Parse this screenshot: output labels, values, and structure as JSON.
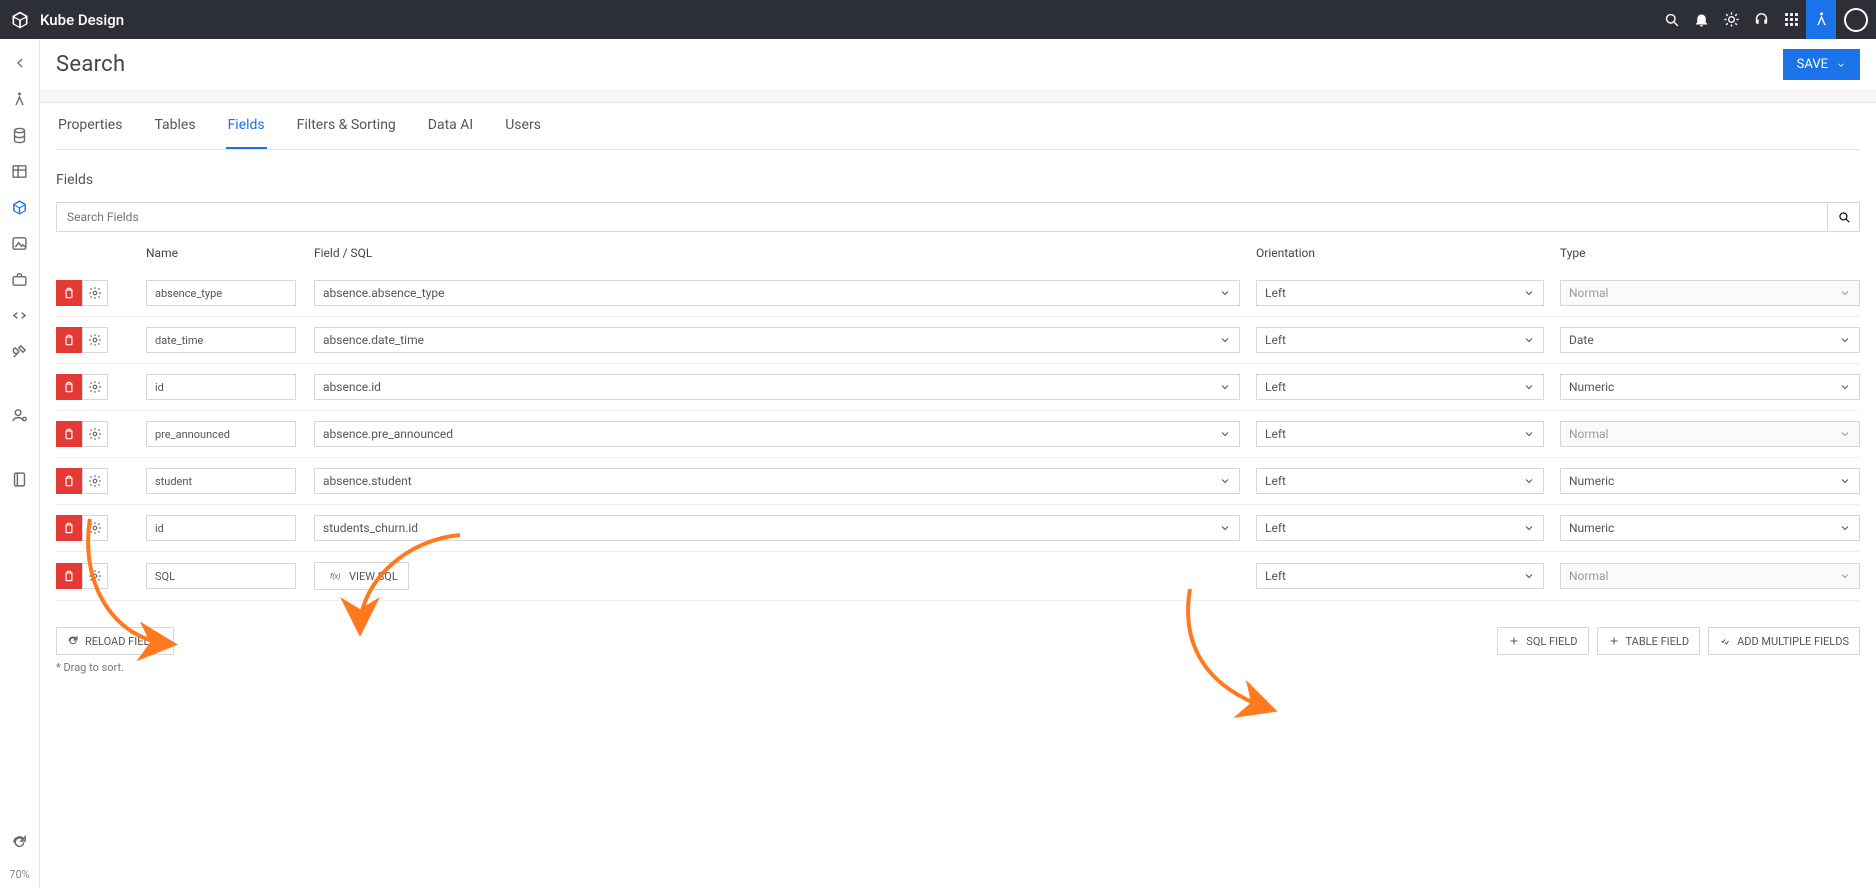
{
  "app": {
    "title": "Kube Design"
  },
  "page": {
    "title": "Search",
    "save": "SAVE"
  },
  "tabs": [
    {
      "label": "Properties",
      "active": false
    },
    {
      "label": "Tables",
      "active": false
    },
    {
      "label": "Fields",
      "active": true
    },
    {
      "label": "Filters & Sorting",
      "active": false
    },
    {
      "label": "Data AI",
      "active": false
    },
    {
      "label": "Users",
      "active": false
    }
  ],
  "section": {
    "title": "Fields"
  },
  "search": {
    "placeholder": "Search Fields"
  },
  "columns": {
    "name": "Name",
    "field": "Field / SQL",
    "orient": "Orientation",
    "type": "Type"
  },
  "rows": [
    {
      "name": "absence_type",
      "field": "absence.absence_type",
      "orient": "Left",
      "type": "Normal",
      "type_readonly": true,
      "sql": false
    },
    {
      "name": "date_time",
      "field": "absence.date_time",
      "orient": "Left",
      "type": "Date",
      "type_readonly": false,
      "sql": false
    },
    {
      "name": "id",
      "field": "absence.id",
      "orient": "Left",
      "type": "Numeric",
      "type_readonly": false,
      "sql": false
    },
    {
      "name": "pre_announced",
      "field": "absence.pre_announced",
      "orient": "Left",
      "type": "Normal",
      "type_readonly": true,
      "sql": false
    },
    {
      "name": "student",
      "field": "absence.student",
      "orient": "Left",
      "type": "Numeric",
      "type_readonly": false,
      "sql": false
    },
    {
      "name": "id",
      "field": "students_churn.id",
      "orient": "Left",
      "type": "Numeric",
      "type_readonly": false,
      "sql": false
    },
    {
      "name": "SQL",
      "field": "",
      "orient": "Left",
      "type": "Normal",
      "type_readonly": true,
      "sql": true
    }
  ],
  "viewsql": "VIEW SQL",
  "footer": {
    "reload": "RELOAD FIELDS",
    "hint": "* Drag to sort.",
    "sqlfield": "SQL FIELD",
    "tablefield": "TABLE FIELD",
    "multi": "ADD MULTIPLE FIELDS"
  },
  "leftrail": {
    "pct": "70%"
  }
}
